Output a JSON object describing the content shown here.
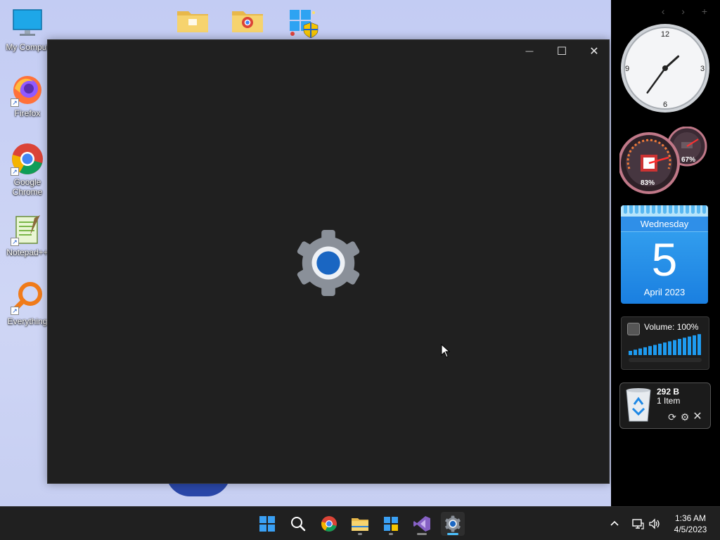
{
  "desktop": {
    "icons": [
      {
        "label": "My Comput",
        "icon": "computer-icon"
      },
      {
        "label": "Firefox",
        "icon": "firefox-icon"
      },
      {
        "label": "Google Chrome",
        "icon": "chrome-icon"
      },
      {
        "label": "Notepad++",
        "icon": "notepad-plus-plus-icon"
      },
      {
        "label": "Everything",
        "icon": "everything-search-icon"
      }
    ],
    "top_icons": [
      "folder-icon",
      "chrome-folder-icon",
      "windows-tools-icon"
    ]
  },
  "settings_window": {
    "minimize": "—",
    "maximize": "☐",
    "close": "✕",
    "splash_icon": "settings-gear-icon"
  },
  "sidebar": {
    "nav": "‹ › +",
    "clock": {
      "n12": "12",
      "n3": "3",
      "n6": "6",
      "n9": "9",
      "hour": 1,
      "minute": 36
    },
    "meter": {
      "cpu": "83%",
      "ram": "67%"
    },
    "calendar": {
      "weekday": "Wednesday",
      "day": "5",
      "month_year": "April 2023"
    },
    "volume": {
      "label": "Volume: 100%",
      "level": 1.0
    },
    "recycle_bin": {
      "size": "292 B",
      "items": "1 Item"
    }
  },
  "taskbar": {
    "apps": [
      "start-icon",
      "search-icon",
      "chrome-icon",
      "file-explorer-icon",
      "widgets-icon",
      "visual-studio-icon",
      "settings-icon"
    ],
    "time": "1:36 AM",
    "date": "4/5/2023"
  },
  "colors": {
    "accent": "#1a66c2",
    "window_bg": "#202020",
    "taskbar_bg": "#202020",
    "desktop_bg": "#c9d3f4"
  }
}
